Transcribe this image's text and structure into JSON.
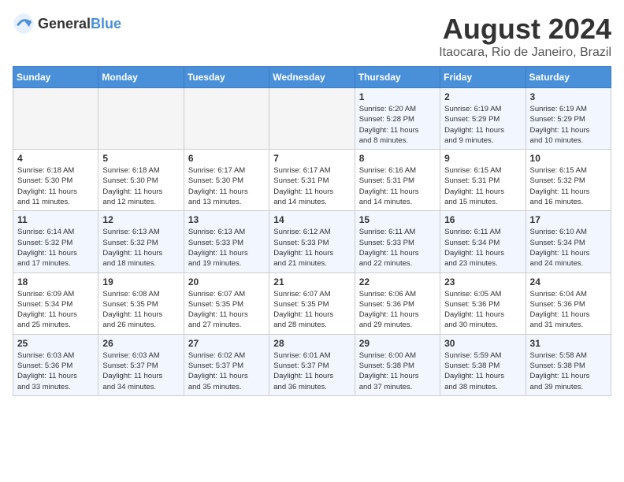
{
  "header": {
    "logo_general": "General",
    "logo_blue": "Blue",
    "month_year": "August 2024",
    "location": "Itaocara, Rio de Janeiro, Brazil"
  },
  "days_of_week": [
    "Sunday",
    "Monday",
    "Tuesday",
    "Wednesday",
    "Thursday",
    "Friday",
    "Saturday"
  ],
  "weeks": [
    [
      {
        "day": "",
        "info": ""
      },
      {
        "day": "",
        "info": ""
      },
      {
        "day": "",
        "info": ""
      },
      {
        "day": "",
        "info": ""
      },
      {
        "day": "1",
        "info": "Sunrise: 6:20 AM\nSunset: 5:28 PM\nDaylight: 11 hours\nand 8 minutes."
      },
      {
        "day": "2",
        "info": "Sunrise: 6:19 AM\nSunset: 5:29 PM\nDaylight: 11 hours\nand 9 minutes."
      },
      {
        "day": "3",
        "info": "Sunrise: 6:19 AM\nSunset: 5:29 PM\nDaylight: 11 hours\nand 10 minutes."
      }
    ],
    [
      {
        "day": "4",
        "info": "Sunrise: 6:18 AM\nSunset: 5:30 PM\nDaylight: 11 hours\nand 11 minutes."
      },
      {
        "day": "5",
        "info": "Sunrise: 6:18 AM\nSunset: 5:30 PM\nDaylight: 11 hours\nand 12 minutes."
      },
      {
        "day": "6",
        "info": "Sunrise: 6:17 AM\nSunset: 5:30 PM\nDaylight: 11 hours\nand 13 minutes."
      },
      {
        "day": "7",
        "info": "Sunrise: 6:17 AM\nSunset: 5:31 PM\nDaylight: 11 hours\nand 14 minutes."
      },
      {
        "day": "8",
        "info": "Sunrise: 6:16 AM\nSunset: 5:31 PM\nDaylight: 11 hours\nand 14 minutes."
      },
      {
        "day": "9",
        "info": "Sunrise: 6:15 AM\nSunset: 5:31 PM\nDaylight: 11 hours\nand 15 minutes."
      },
      {
        "day": "10",
        "info": "Sunrise: 6:15 AM\nSunset: 5:32 PM\nDaylight: 11 hours\nand 16 minutes."
      }
    ],
    [
      {
        "day": "11",
        "info": "Sunrise: 6:14 AM\nSunset: 5:32 PM\nDaylight: 11 hours\nand 17 minutes."
      },
      {
        "day": "12",
        "info": "Sunrise: 6:13 AM\nSunset: 5:32 PM\nDaylight: 11 hours\nand 18 minutes."
      },
      {
        "day": "13",
        "info": "Sunrise: 6:13 AM\nSunset: 5:33 PM\nDaylight: 11 hours\nand 19 minutes."
      },
      {
        "day": "14",
        "info": "Sunrise: 6:12 AM\nSunset: 5:33 PM\nDaylight: 11 hours\nand 21 minutes."
      },
      {
        "day": "15",
        "info": "Sunrise: 6:11 AM\nSunset: 5:33 PM\nDaylight: 11 hours\nand 22 minutes."
      },
      {
        "day": "16",
        "info": "Sunrise: 6:11 AM\nSunset: 5:34 PM\nDaylight: 11 hours\nand 23 minutes."
      },
      {
        "day": "17",
        "info": "Sunrise: 6:10 AM\nSunset: 5:34 PM\nDaylight: 11 hours\nand 24 minutes."
      }
    ],
    [
      {
        "day": "18",
        "info": "Sunrise: 6:09 AM\nSunset: 5:34 PM\nDaylight: 11 hours\nand 25 minutes."
      },
      {
        "day": "19",
        "info": "Sunrise: 6:08 AM\nSunset: 5:35 PM\nDaylight: 11 hours\nand 26 minutes."
      },
      {
        "day": "20",
        "info": "Sunrise: 6:07 AM\nSunset: 5:35 PM\nDaylight: 11 hours\nand 27 minutes."
      },
      {
        "day": "21",
        "info": "Sunrise: 6:07 AM\nSunset: 5:35 PM\nDaylight: 11 hours\nand 28 minutes."
      },
      {
        "day": "22",
        "info": "Sunrise: 6:06 AM\nSunset: 5:36 PM\nDaylight: 11 hours\nand 29 minutes."
      },
      {
        "day": "23",
        "info": "Sunrise: 6:05 AM\nSunset: 5:36 PM\nDaylight: 11 hours\nand 30 minutes."
      },
      {
        "day": "24",
        "info": "Sunrise: 6:04 AM\nSunset: 5:36 PM\nDaylight: 11 hours\nand 31 minutes."
      }
    ],
    [
      {
        "day": "25",
        "info": "Sunrise: 6:03 AM\nSunset: 5:36 PM\nDaylight: 11 hours\nand 33 minutes."
      },
      {
        "day": "26",
        "info": "Sunrise: 6:03 AM\nSunset: 5:37 PM\nDaylight: 11 hours\nand 34 minutes."
      },
      {
        "day": "27",
        "info": "Sunrise: 6:02 AM\nSunset: 5:37 PM\nDaylight: 11 hours\nand 35 minutes."
      },
      {
        "day": "28",
        "info": "Sunrise: 6:01 AM\nSunset: 5:37 PM\nDaylight: 11 hours\nand 36 minutes."
      },
      {
        "day": "29",
        "info": "Sunrise: 6:00 AM\nSunset: 5:38 PM\nDaylight: 11 hours\nand 37 minutes."
      },
      {
        "day": "30",
        "info": "Sunrise: 5:59 AM\nSunset: 5:38 PM\nDaylight: 11 hours\nand 38 minutes."
      },
      {
        "day": "31",
        "info": "Sunrise: 5:58 AM\nSunset: 5:38 PM\nDaylight: 11 hours\nand 39 minutes."
      }
    ]
  ]
}
